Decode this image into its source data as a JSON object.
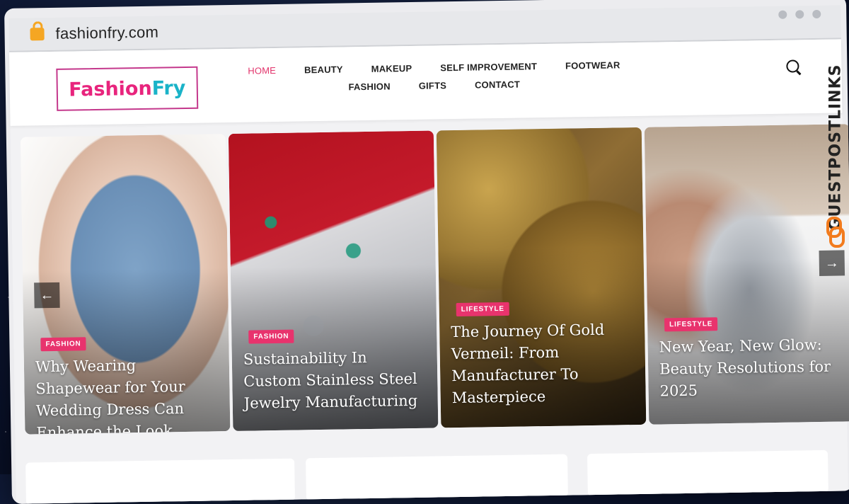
{
  "browser": {
    "url": "fashionfry.com"
  },
  "header": {
    "logo_part1": "Fashion",
    "logo_part2": "Fry",
    "nav_row1": [
      "HOME",
      "BEAUTY",
      "MAKEUP",
      "SELF IMPROVEMENT",
      "FOOTWEAR"
    ],
    "nav_row2": [
      "FASHION",
      "GIFTS",
      "CONTACT"
    ]
  },
  "slider": {
    "prev_label": "←",
    "next_label": "→",
    "cards": [
      {
        "category": "FASHION",
        "title": "Why Wearing Shapewear for Your Wedding Dress Can Enhance the Look"
      },
      {
        "category": "FASHION",
        "title": "Sustainability In Custom Stainless Steel Jewelry Manufacturing"
      },
      {
        "category": "LIFESTYLE",
        "title": "The Journey Of Gold Vermeil: From Manufacturer To Masterpiece"
      },
      {
        "category": "LIFESTYLE",
        "title": "New Year, New Glow: Beauty Resolutions for 2025"
      }
    ]
  },
  "watermark": {
    "text": "GUESTPOSTLINKS"
  },
  "colors": {
    "accent": "#e2336b",
    "logo_pink": "#e8247d",
    "logo_cyan": "#1ab3c8",
    "watermark_orange": "#f27b1d"
  }
}
